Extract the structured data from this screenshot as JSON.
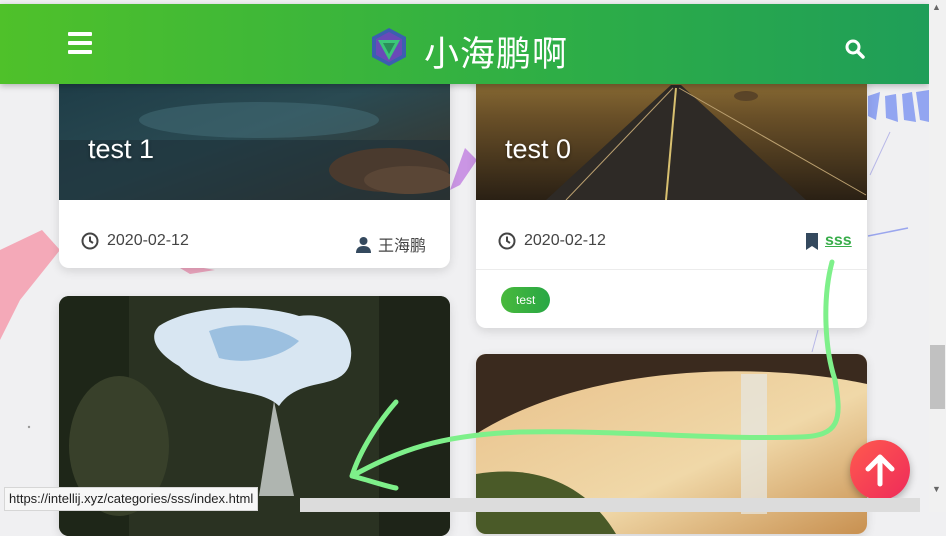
{
  "header": {
    "site_title": "小海鹏啊",
    "menu_icon": "menu-icon",
    "search_icon": "search-icon",
    "logo_icon": "logo-icon"
  },
  "posts": [
    {
      "title": "test 1",
      "date": "2020-02-12",
      "author": "王海鹏"
    },
    {
      "title": "test 0",
      "date": "2020-02-12",
      "category": "sss",
      "tags": [
        "test"
      ]
    }
  ],
  "status_bar": {
    "url": "https://intellij.xyz/categories/sss/index.html"
  },
  "colors": {
    "header_start": "#4fc12a",
    "header_end": "#1f9e58",
    "accent": "#38ad4a",
    "back_to_top": "#ff4a55"
  }
}
